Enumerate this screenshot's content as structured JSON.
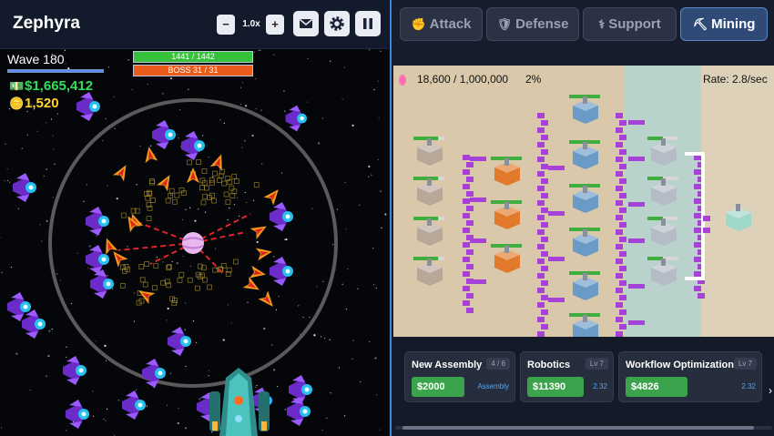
{
  "game": {
    "title": "Zephyra",
    "speed_label": "1.0x",
    "speed_down": "−",
    "speed_up": "+",
    "wave_label": "Wave 180",
    "wave_progress": 1.0,
    "money": "$1,665,412",
    "gold": "1,520",
    "player_health": {
      "text": "1441 / 1442",
      "fraction": 0.999,
      "color": "#36c23b"
    },
    "boss_bar": {
      "text": "BOSS 31 / 31",
      "fraction": 1.0,
      "color": "#ea5a1b"
    }
  },
  "tabs": [
    {
      "label": "Attack",
      "icon": "fist-icon",
      "active": false
    },
    {
      "label": "Defense",
      "icon": "shield-icon",
      "active": false
    },
    {
      "label": "Support",
      "icon": "support-icon",
      "active": false
    },
    {
      "label": "Mining",
      "icon": "drill-icon",
      "active": true
    }
  ],
  "factory": {
    "ore_count": "18,600 / 1,000,000",
    "ore_percent": "2%",
    "rate": "Rate: 2.8/sec"
  },
  "upgrades": [
    {
      "title": "New Assembly",
      "level": "4 / 6",
      "price": "$2000",
      "note": "Assembly"
    },
    {
      "title": "Robotics",
      "level": "Lv 7",
      "price": "$11390",
      "note": "2.32"
    },
    {
      "title": "Workflow Optimization",
      "level": "Lv 7",
      "price": "$4826",
      "note": "2.32"
    }
  ],
  "colors": {
    "accent": "#3e86d9",
    "buy_button": "#3ba34b",
    "money": "#2ee05a",
    "gold": "#ffd42a",
    "pipe": "#a642d8"
  }
}
